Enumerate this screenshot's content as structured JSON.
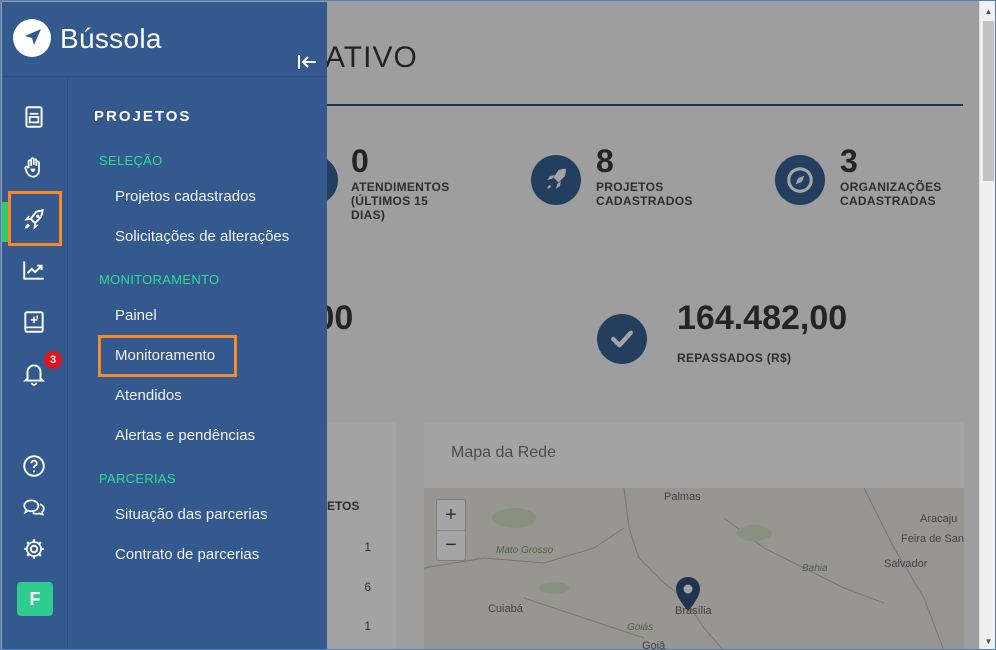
{
  "app": {
    "name": "Bússola"
  },
  "page": {
    "title_fragment": "ATIVO"
  },
  "stats": [
    {
      "value": "0",
      "label": "ATENDIMENTOS (ÚLTIMOS 15 DIAS)",
      "icon": "partial-icon"
    },
    {
      "value": "8",
      "label": "PROJETOS CADASTRADOS",
      "icon": "rocket-icon"
    },
    {
      "value": "3",
      "label": "ORGANIZAÇÕES CADASTRADAS",
      "icon": "compass-icon"
    }
  ],
  "financial": [
    {
      "value": ",00",
      "label": ""
    },
    {
      "value": "164.482,00",
      "label": "REPASSADOS (R$)",
      "icon": "check-circle-icon"
    }
  ],
  "table": {
    "header": "ETOS",
    "cells": [
      "1",
      "6",
      "1"
    ]
  },
  "map": {
    "title": "Mapa da Rede",
    "zoom_in": "+",
    "zoom_out": "−",
    "labels": [
      "Palmas",
      "Aracaju",
      "Feira de San",
      "Mato Grosso",
      "Bahia",
      "Salvador",
      "Cuiabá",
      "Brasília",
      "Goiás",
      "Goiâ"
    ]
  },
  "sidebar": {
    "heading": "PROJETOS",
    "sections": [
      {
        "title": "SELEÇÃO",
        "items": [
          "Projetos cadastrados",
          "Solicitações de alterações"
        ]
      },
      {
        "title": "MONITORAMENTO",
        "items": [
          "Painel",
          "Monitoramento",
          "Atendidos",
          "Alertas e pendências"
        ]
      },
      {
        "title": "PARCERIAS",
        "items": [
          "Situação das parcerias",
          "Contrato de parcerias"
        ]
      }
    ],
    "notification_count": "3",
    "avatar_initial": "F"
  },
  "colors": {
    "sidebar_bg": "#34598f",
    "accent_green": "#2edb93",
    "highlight_orange": "#f6892b",
    "badge_red": "#e0141e"
  }
}
